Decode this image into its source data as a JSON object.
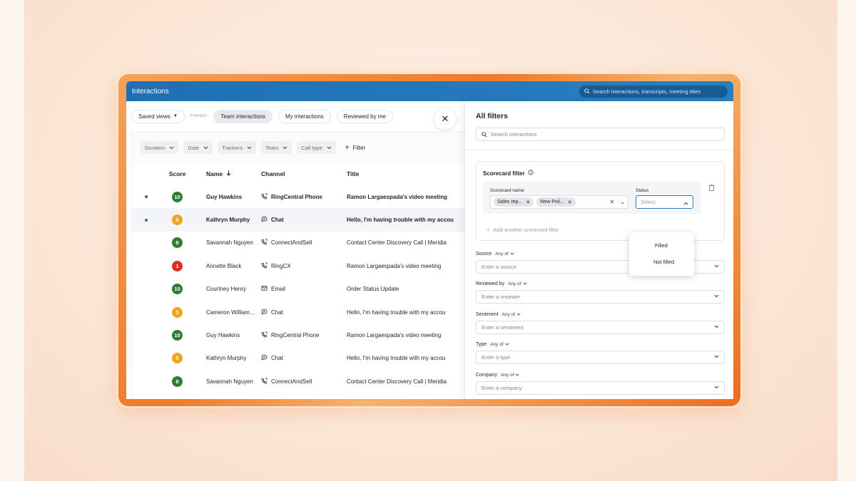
{
  "window": {
    "title": "Interactions"
  },
  "global_search": {
    "placeholder": "Search interactions, transcripts, meeting titles"
  },
  "views": {
    "saved_views_label": "Saved views",
    "pinned_label": "PINNED:",
    "tabs": [
      {
        "label": "Team interactions",
        "active": true
      },
      {
        "label": "My interactions",
        "active": false
      },
      {
        "label": "Reviewed by me",
        "active": false
      }
    ]
  },
  "filters": {
    "chips": [
      "Duration",
      "Date",
      "Trackers",
      "Team",
      "Call type"
    ],
    "add_filter_label": "Filter"
  },
  "table": {
    "columns": {
      "score": "Score",
      "name": "Name",
      "channel": "Channel",
      "title": "Title"
    },
    "rows": [
      {
        "unread": true,
        "score": "10",
        "score_color": "#2e7d32",
        "name": "Guy Hawkins",
        "channel_icon": "phone-icon",
        "channel": "RingCentral Phone",
        "title": "Ramon Largaespada's video meeting",
        "bold": true,
        "selected": false
      },
      {
        "unread": true,
        "score": "5",
        "score_color": "#f2a51a",
        "name": "Kathryn Murphy",
        "channel_icon": "chat-icon",
        "channel": "Chat",
        "title": "Hello, I'm having trouble with my accou",
        "bold": true,
        "selected": true
      },
      {
        "unread": false,
        "score": "8",
        "score_color": "#2e7d32",
        "name": "Savannah Nguyen",
        "channel_icon": "phone-icon",
        "channel": "ConnectAndSell",
        "title": "Contact Center Discovery Call | Meridia",
        "bold": false,
        "selected": false
      },
      {
        "unread": false,
        "score": "1",
        "score_color": "#d93025",
        "name": "Annette Black",
        "channel_icon": "phone-icon",
        "channel": "RingCX",
        "title": "Ramon Largaespada's video meeting",
        "bold": false,
        "selected": false
      },
      {
        "unread": false,
        "score": "10",
        "score_color": "#2e7d32",
        "name": "Courtney Henry",
        "channel_icon": "email-icon",
        "channel": "Email",
        "title": "Order Status Update",
        "bold": false,
        "selected": false
      },
      {
        "unread": false,
        "score": "5",
        "score_color": "#f2a51a",
        "name": "Cameron William...",
        "channel_icon": "chat-icon",
        "channel": "Chat",
        "title": "Hello, I'm having trouble with my accou",
        "bold": false,
        "selected": false
      },
      {
        "unread": false,
        "score": "10",
        "score_color": "#2e7d32",
        "name": "Guy Hawkins",
        "channel_icon": "phone-icon",
        "channel": "RingCentral Phone",
        "title": "Ramon Largaespada's video meeting",
        "bold": false,
        "selected": false
      },
      {
        "unread": false,
        "score": "5",
        "score_color": "#f2a51a",
        "name": "Kathryn Murphy",
        "channel_icon": "chat-icon",
        "channel": "Chat",
        "title": "Hello, I'm having trouble with my accou",
        "bold": false,
        "selected": false
      },
      {
        "unread": false,
        "score": "8",
        "score_color": "#2e7d32",
        "name": "Savannah Nguyen",
        "channel_icon": "phone-icon",
        "channel": "ConnectAndSell",
        "title": "Contact Center Discovery Call | Meridia",
        "bold": false,
        "selected": false
      }
    ]
  },
  "panel": {
    "title": "All filters",
    "search_placeholder": "Search interactions",
    "scorecard": {
      "title": "Scorecard filter",
      "name_label": "Scorecard name",
      "tags": [
        "Sales rep...",
        "New Poli..."
      ],
      "status_label": "Status",
      "status_placeholder": "Select",
      "status_options": [
        "Filled",
        "Not filled"
      ],
      "add_label": "Add another scorecard filter"
    },
    "groups": [
      {
        "label": "Source",
        "mode": "Any of",
        "placeholder": "Enter a source"
      },
      {
        "label": "Reviewed by",
        "mode": "Any of",
        "placeholder": "Enter a reviewer"
      },
      {
        "label": "Sentiment",
        "mode": "Any of",
        "placeholder": "Enter a sentiment"
      },
      {
        "label": "Type",
        "mode": "Any of",
        "placeholder": "Enter a type"
      },
      {
        "label": "Company",
        "mode": "Any of",
        "placeholder": "Enter a company"
      }
    ]
  },
  "colors": {
    "accent": "#2a7fc1",
    "title_bar": "#1f6fb5",
    "frame": "#f07a2a"
  }
}
